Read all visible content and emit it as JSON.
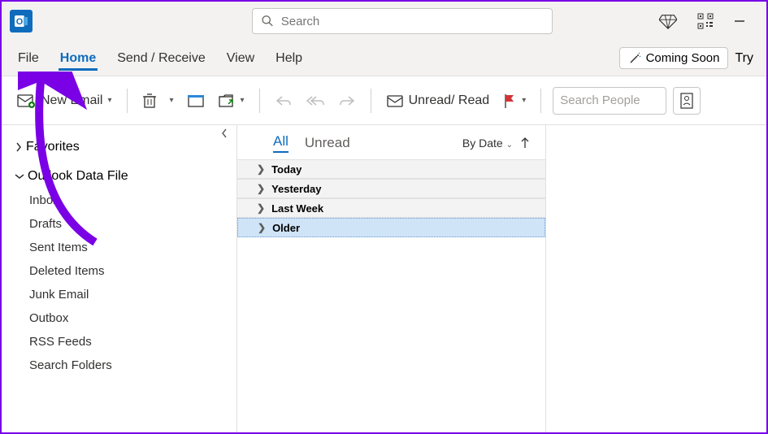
{
  "titlebar": {
    "search_placeholder": "Search"
  },
  "menubar": {
    "file": "File",
    "home": "Home",
    "sendreceive": "Send / Receive",
    "view": "View",
    "help": "Help",
    "coming_soon": "Coming Soon",
    "try": "Try"
  },
  "toolbar": {
    "new_email": "New Email",
    "unread_read": "Unread/ Read",
    "search_people_placeholder": "Search People"
  },
  "sidebar": {
    "favorites": "Favorites",
    "datafile_label": "Outlook Data File",
    "folders": [
      "Inbox",
      "Drafts",
      "Sent Items",
      "Deleted Items",
      "Junk Email",
      "Outbox",
      "RSS Feeds",
      "Search Folders"
    ]
  },
  "listpane": {
    "tab_all": "All",
    "tab_unread": "Unread",
    "sort_label": "By Date",
    "groups": [
      "Today",
      "Yesterday",
      "Last Week",
      "Older"
    ]
  }
}
